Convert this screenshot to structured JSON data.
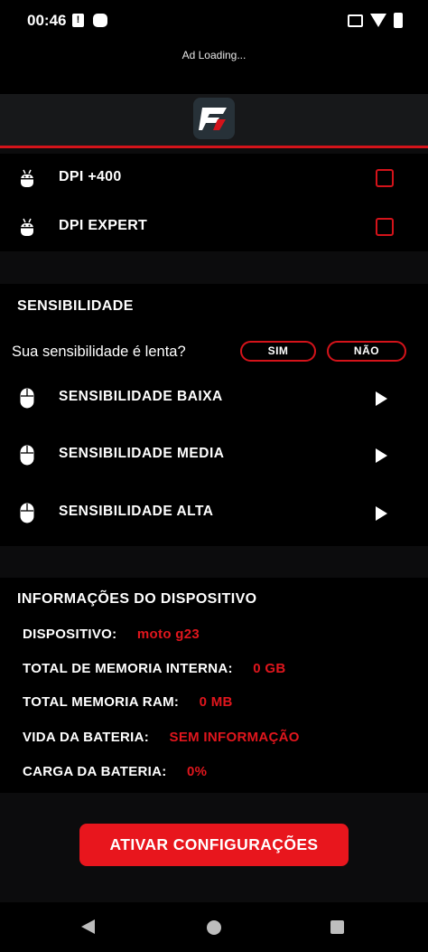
{
  "status_bar": {
    "time": "00:46",
    "alert_glyph": "!"
  },
  "ad": {
    "text": "Ad Loading..."
  },
  "colors": {
    "accent": "#d4131a",
    "background": "#0c0c0d",
    "section": "#000000",
    "header": "#17181a"
  },
  "dpi": {
    "items": [
      {
        "label": "DPI +400",
        "icon": "android-icon",
        "checked": false
      },
      {
        "label": "DPI EXPERT",
        "icon": "android-icon",
        "checked": false
      }
    ]
  },
  "sensibilidade": {
    "title": "SENSIBILIDADE",
    "question": "Sua sensibilidade é lenta?",
    "yes_label": "SIM",
    "no_label": "NÃO",
    "items": [
      {
        "label": "SENSIBILIDADE BAIXA",
        "icon": "mouse-icon"
      },
      {
        "label": "SENSIBILIDADE MEDIA",
        "icon": "mouse-icon"
      },
      {
        "label": "SENSIBILIDADE ALTA",
        "icon": "mouse-icon"
      }
    ]
  },
  "info": {
    "title": "INFORMAÇÕES DO DISPOSITIVO",
    "rows": [
      {
        "label": "DISPOSITIVO:",
        "value": "moto g23"
      },
      {
        "label": "TOTAL DE MEMORIA INTERNA:",
        "value": "0 GB"
      },
      {
        "label": "TOTAL MEMORIA RAM:",
        "value": "0 MB"
      },
      {
        "label": "VIDA DA BATERIA:",
        "value": "SEM INFORMAÇÃO"
      },
      {
        "label": "CARGA DA BATERIA:",
        "value": "0%"
      }
    ]
  },
  "cta": {
    "label": "ATIVAR CONFIGURAÇÕES"
  }
}
